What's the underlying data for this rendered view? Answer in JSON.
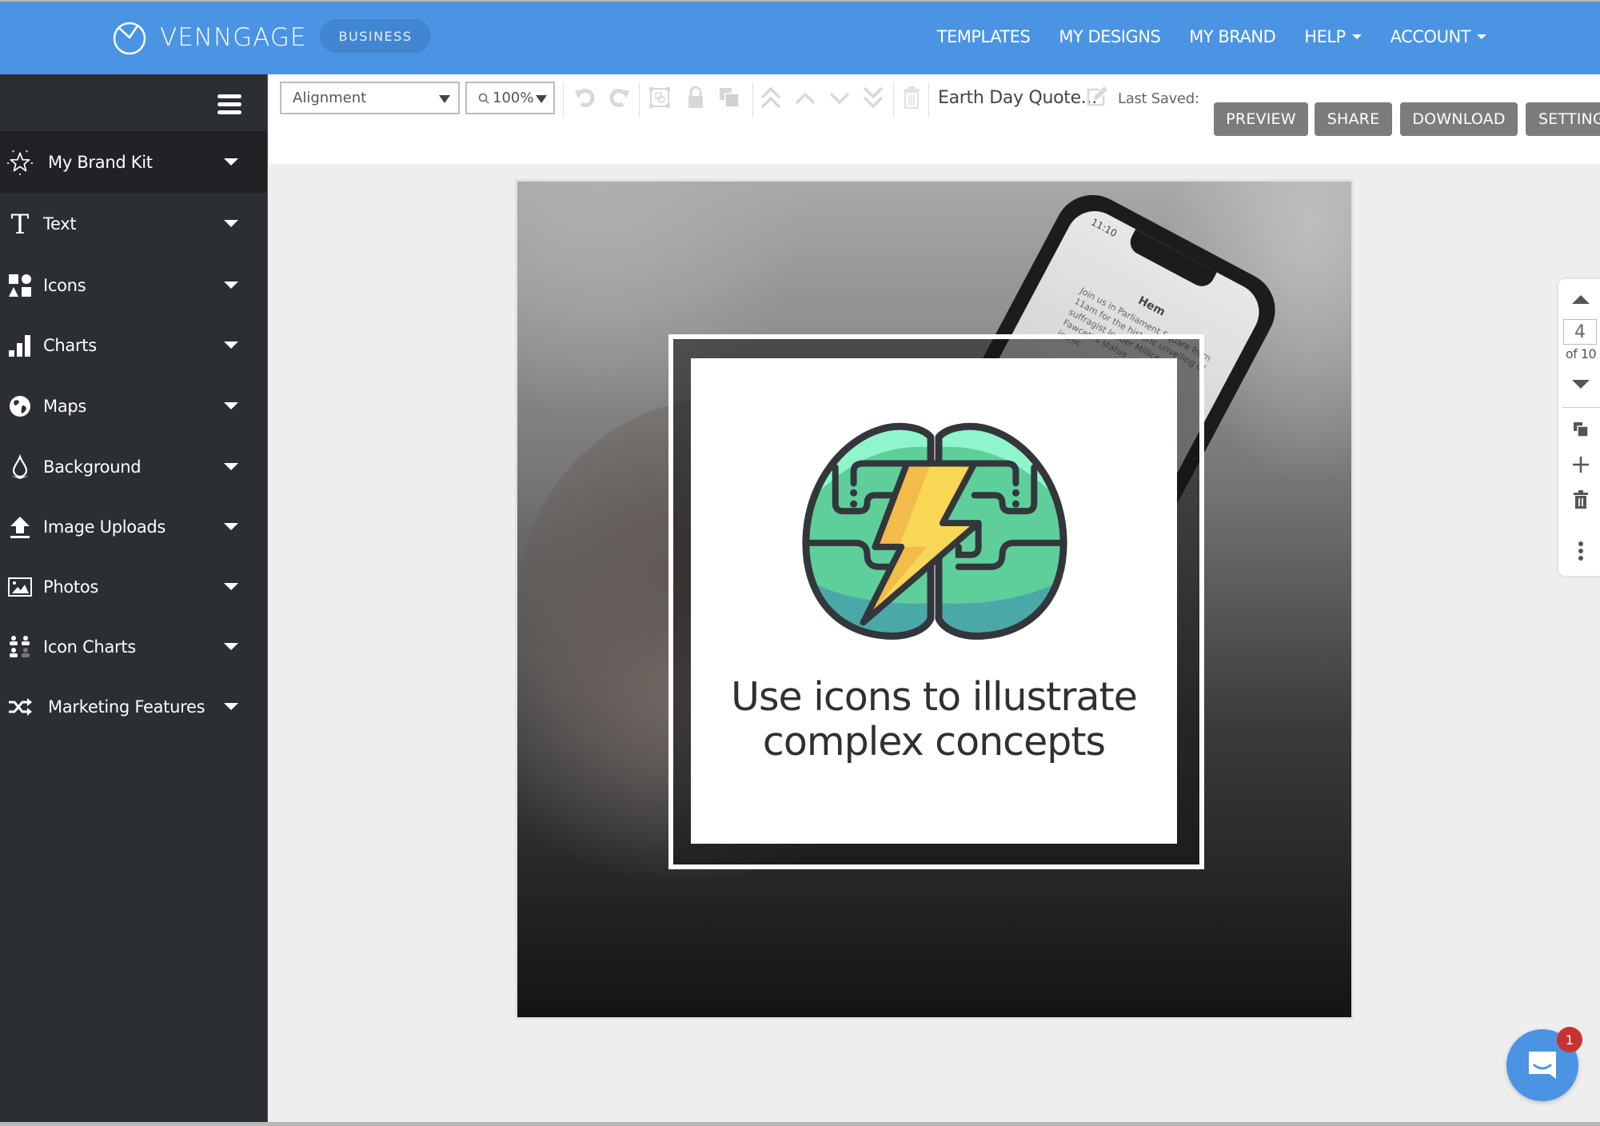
{
  "header": {
    "brand_name": "VENNGAGE",
    "plan_badge": "BUSINESS",
    "nav": [
      {
        "label": "TEMPLATES",
        "dropdown": false
      },
      {
        "label": "MY DESIGNS",
        "dropdown": false
      },
      {
        "label": "MY BRAND",
        "dropdown": false
      },
      {
        "label": "HELP",
        "dropdown": true
      },
      {
        "label": "ACCOUNT",
        "dropdown": true
      }
    ]
  },
  "sidebar": {
    "menu_icon": "hamburger-icon",
    "items": [
      {
        "label": "My Brand Kit",
        "icon": "star-icon",
        "active": true
      },
      {
        "label": "Text",
        "icon": "text-icon",
        "active": false
      },
      {
        "label": "Icons",
        "icon": "shapes-icon",
        "active": false
      },
      {
        "label": "Charts",
        "icon": "bar-chart-icon",
        "active": false
      },
      {
        "label": "Maps",
        "icon": "globe-icon",
        "active": false
      },
      {
        "label": "Background",
        "icon": "droplet-icon",
        "active": false
      },
      {
        "label": "Image Uploads",
        "icon": "upload-icon",
        "active": false
      },
      {
        "label": "Photos",
        "icon": "photo-icon",
        "active": false
      },
      {
        "label": "Icon Charts",
        "icon": "people-icon",
        "active": false
      },
      {
        "label": "Marketing Features",
        "icon": "shuffle-icon",
        "active": false
      }
    ]
  },
  "toolbar": {
    "alignment_select": "Alignment",
    "zoom_select": "100%",
    "icons": [
      "undo-icon",
      "redo-icon",
      "group-icon",
      "lock-icon",
      "duplicate-icon",
      "bring-to-front-icon",
      "bring-forward-icon",
      "send-backward-icon",
      "send-to-back-icon",
      "delete-icon"
    ],
    "document_title": "Earth Day Quote...",
    "edit_title_icon": "edit-icon",
    "last_saved_label": "Last Saved:",
    "actions": [
      "PREVIEW",
      "SHARE",
      "DOWNLOAD",
      "SETTINGS"
    ]
  },
  "canvas": {
    "card_text_line1": "Use icons to illustrate",
    "card_text_line2": "complex concepts",
    "illustration": "brain-lightning-icon",
    "background_photo": {
      "phone_time": "11:10",
      "phone_contact": "Hem",
      "phone_message": "Join us in Parliament Square from 11am for the historic unveiling of suffragist leader Millicent Fawcett's statue – the first... iconic"
    },
    "colors": {
      "brain_light": "#8ff5cc",
      "brain_mid": "#5ecf9b",
      "brain_dark": "#4aa8a8",
      "bolt_light": "#f8d756",
      "bolt_dark": "#f2bb4a",
      "outline": "#33363a"
    }
  },
  "pager": {
    "current_page": "4",
    "total_label": "of 10",
    "tools": [
      "duplicate-page-icon",
      "add-page-icon",
      "delete-page-icon",
      "more-icon"
    ]
  },
  "chat": {
    "badge_count": "1"
  },
  "colors": {
    "header_bg": "#4a94e3",
    "sidebar_bg": "#2b2e33",
    "action_button_bg": "#7c7c7c",
    "badge_red": "#c83232"
  }
}
